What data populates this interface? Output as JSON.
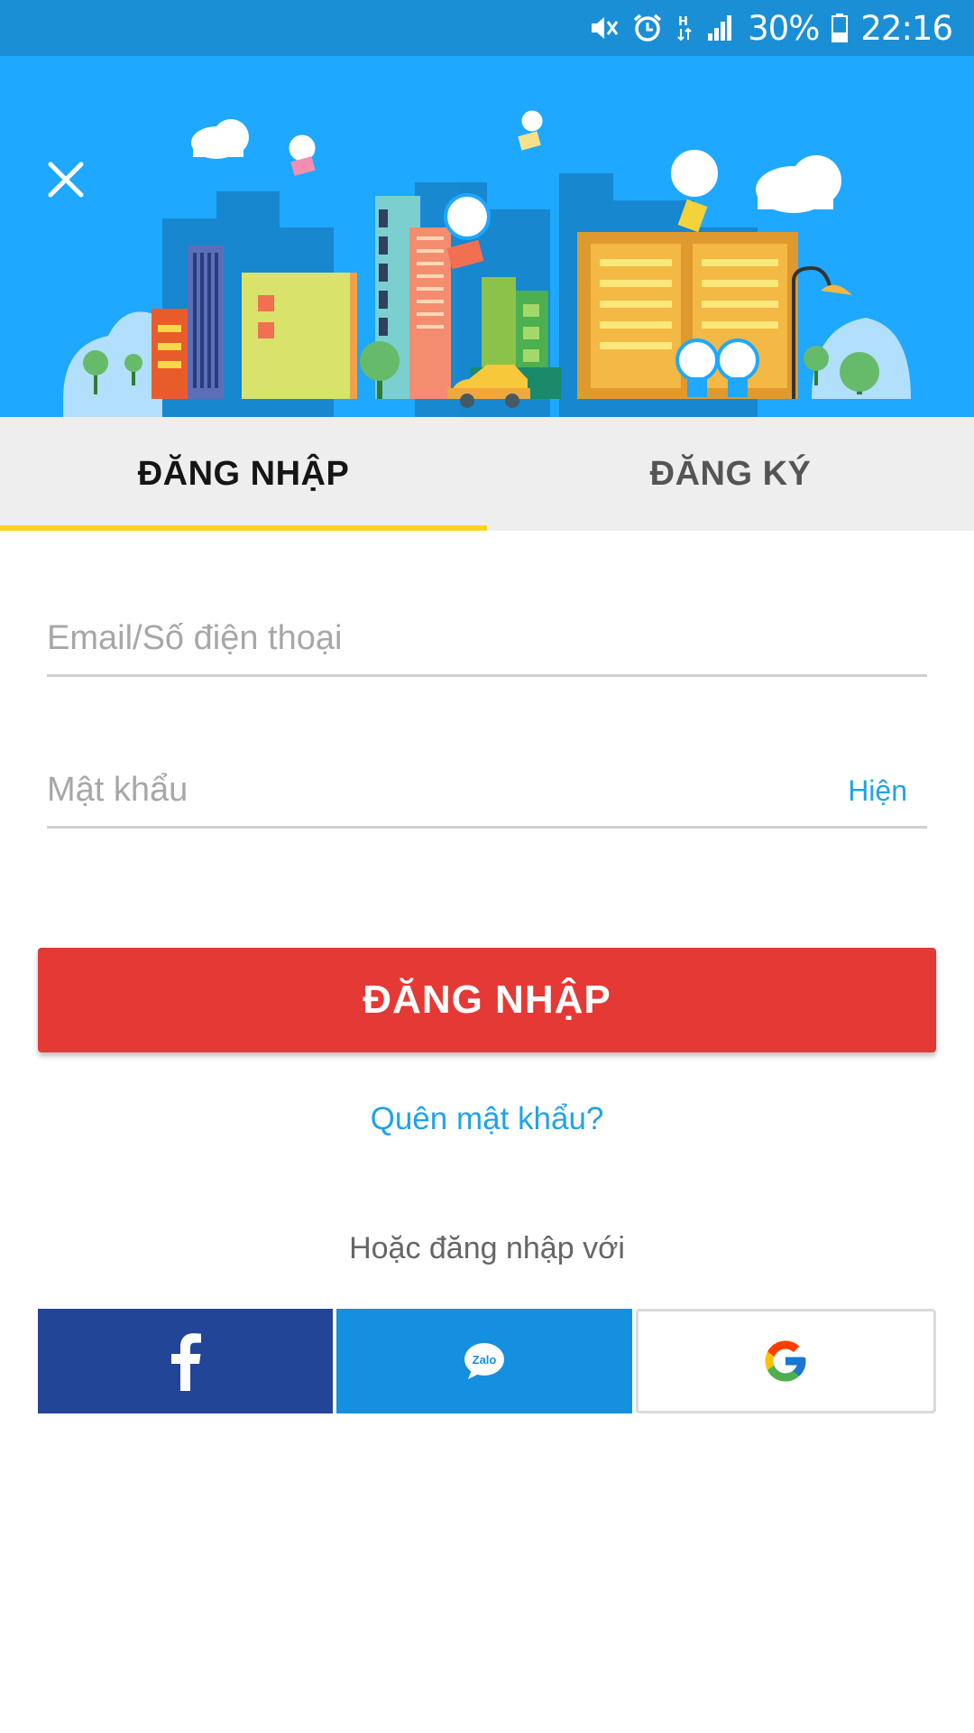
{
  "status_bar": {
    "battery": "30%",
    "time": "22:16",
    "icons": [
      "mute-icon",
      "alarm-icon",
      "data-h-icon",
      "signal-icon",
      "battery-icon"
    ]
  },
  "header": {
    "close_icon": "close-icon",
    "banner_colors": {
      "sky": "#1ea8ff"
    }
  },
  "tabs": [
    {
      "label": "ĐĂNG NHẬP",
      "active": true
    },
    {
      "label": "ĐĂNG KÝ",
      "active": false
    }
  ],
  "form": {
    "email_placeholder": "Email/Số điện thoại",
    "email_value": "",
    "password_placeholder": "Mật khẩu",
    "password_value": "",
    "show_label": "Hiện",
    "login_label": "ĐĂNG NHẬP",
    "forgot_label": "Quên mật khẩu?",
    "or_label": "Hoặc đăng nhập với"
  },
  "social": [
    {
      "name": "facebook",
      "icon": "facebook-icon",
      "color": "#234597"
    },
    {
      "name": "zalo",
      "icon": "zalo-icon",
      "label": "Zalo",
      "color": "#1590e0"
    },
    {
      "name": "google",
      "icon": "google-icon",
      "color": "#ffffff"
    }
  ],
  "colors": {
    "accent_yellow": "#ffd320",
    "primary_red": "#e53935",
    "link_blue": "#21a3e6"
  }
}
